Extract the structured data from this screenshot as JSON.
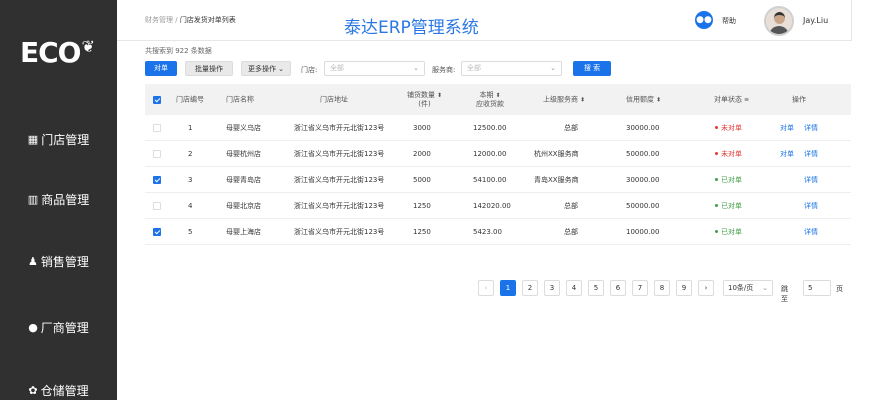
{
  "sidebar": {
    "logo": "ECO",
    "items": [
      {
        "label": "门店管理",
        "icon": "▦"
      },
      {
        "label": "商品管理",
        "icon": "▥"
      },
      {
        "label": "销售管理",
        "icon": "♟"
      },
      {
        "label": "厂商管理",
        "icon": "●"
      },
      {
        "label": "仓储管理",
        "icon": "✿"
      }
    ]
  },
  "header": {
    "breadcrumb_parent": "财务管理",
    "breadcrumb_sep": " / ",
    "breadcrumb_current": "门店发货对单列表",
    "app_title": "泰达ERP管理系统",
    "help_label": "帮助",
    "username": "Jay.Liu"
  },
  "toolbar": {
    "result_count": "共搜索到 922 条数据",
    "reconcile_label": "对单",
    "batch_label": "批量操作",
    "more_label": "更多操作 ⌄",
    "store_label": "门店:",
    "store_placeholder": "全部",
    "provider_label": "服务商:",
    "provider_placeholder": "全部",
    "search_label": "搜 索"
  },
  "table": {
    "headers": {
      "store_no": "门店编号",
      "store_name": "门店名称",
      "address": "门店地址",
      "qty": "铺货数量",
      "qty_unit": "(件)",
      "period": "本期",
      "receivable": "应收货款",
      "provider": "上级服务商",
      "credit": "信用额度",
      "status": "对单状态",
      "status_filter": "≡",
      "ops": "操作"
    },
    "rows": [
      {
        "checked": false,
        "no": "1",
        "name": "母婴义乌店",
        "address": "浙江省义乌市开元北街123号",
        "qty": "3000",
        "amount": "12500.00",
        "provider": "总部",
        "credit": "30000.00",
        "status": "未对单",
        "status_color": "#e53935",
        "op1": "对单",
        "op2": "详情"
      },
      {
        "checked": false,
        "no": "2",
        "name": "母婴杭州店",
        "address": "浙江省义乌市开元北街123号",
        "qty": "2000",
        "amount": "12000.00",
        "provider": "杭州XX服务商",
        "credit": "50000.00",
        "status": "未对单",
        "status_color": "#e53935",
        "op1": "对单",
        "op2": "详情"
      },
      {
        "checked": true,
        "no": "3",
        "name": "母婴青岛店",
        "address": "浙江省义乌市开元北街123号",
        "qty": "5000",
        "amount": "54100.00",
        "provider": "青岛XX服务商",
        "credit": "30000.00",
        "status": "已对单",
        "status_color": "#43a047",
        "op1": "",
        "op2": "详情"
      },
      {
        "checked": false,
        "no": "4",
        "name": "母婴北京店",
        "address": "浙江省义乌市开元北街123号",
        "qty": "1250",
        "amount": "142020.00",
        "provider": "总部",
        "credit": "50000.00",
        "status": "已对单",
        "status_color": "#43a047",
        "op1": "",
        "op2": "详情"
      },
      {
        "checked": true,
        "no": "5",
        "name": "母婴上海店",
        "address": "浙江省义乌市开元北街123号",
        "qty": "1250",
        "amount": "5423.00",
        "provider": "总部",
        "credit": "10000.00",
        "status": "已对单",
        "status_color": "#43a047",
        "op1": "",
        "op2": "详情"
      }
    ]
  },
  "pagination": {
    "prev": "‹",
    "pages": [
      "1",
      "2",
      "3",
      "4",
      "5",
      "6",
      "7",
      "8",
      "9"
    ],
    "current": "1",
    "next": "›",
    "page_size": "10条/页",
    "jump_label": "跳至",
    "jump_value": "5",
    "page_unit": "页"
  }
}
